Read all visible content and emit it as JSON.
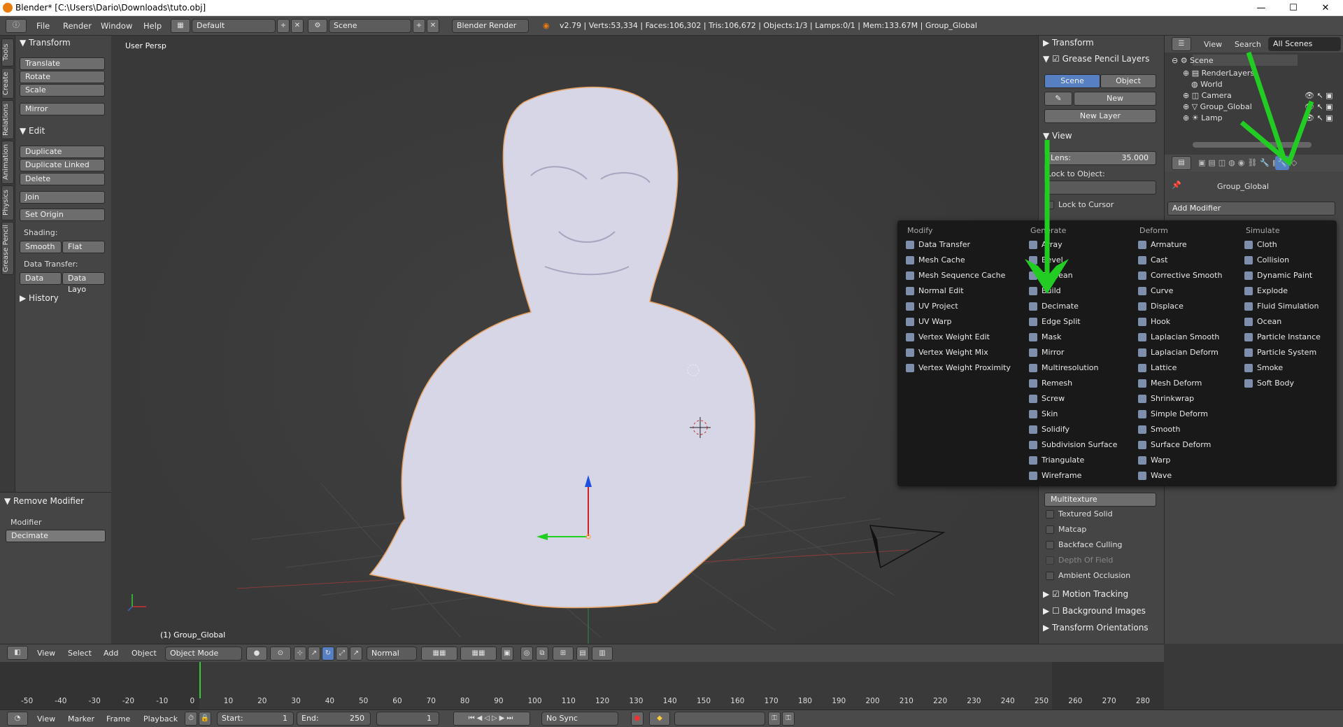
{
  "window": {
    "title": "Blender* [C:\\Users\\Dario\\Downloads\\tuto.obj]",
    "minimize": "—",
    "maximize": "☐",
    "close": "✕"
  },
  "topbar": {
    "menus": [
      "File",
      "Render",
      "Window",
      "Help"
    ],
    "layout": "Default",
    "scene": "Scene",
    "engine": "Blender Render",
    "stats": "v2.79 | Verts:53,334 | Faces:106,302 | Tris:106,672 | Objects:1/3 | Lamps:0/1 | Mem:133.67M | Group_Global"
  },
  "vtabs": [
    "Tools",
    "Create",
    "Relations",
    "Animation",
    "Physics",
    "Grease Pencil"
  ],
  "toolshelf": {
    "transform_header": "Transform",
    "transform_buttons": [
      "Translate",
      "Rotate",
      "Scale",
      "Mirror"
    ],
    "edit_header": "Edit",
    "edit_buttons": [
      "Duplicate",
      "Duplicate Linked",
      "Delete",
      "Join",
      "Set Origin"
    ],
    "shading_label": "Shading:",
    "smooth": "Smooth",
    "flat": "Flat",
    "data_transfer_label": "Data Transfer:",
    "data": "Data",
    "data_layo": "Data Layo",
    "history_header": "History"
  },
  "oppanel": {
    "header": "Remove Modifier",
    "label": "Modifier",
    "value": "Decimate"
  },
  "viewport": {
    "view_label": "User Persp",
    "object_label": "(1) Group_Global"
  },
  "npanel": {
    "transform": "Transform",
    "grease": "Grease Pencil Layers",
    "scene_btn": "Scene",
    "object_btn": "Object",
    "new_btn": "New",
    "new_layer_btn": "New Layer",
    "view": "View",
    "lens_label": "Lens:",
    "lens_value": "35.000",
    "lock_object": "Lock to Object:",
    "lock_cursor": "Lock to Cursor",
    "shading_value": "Multitexture",
    "shading_opts": [
      "Textured Solid",
      "Matcap",
      "Backface Culling",
      "Depth Of Field",
      "Ambient Occlusion"
    ],
    "motion": "Motion Tracking",
    "bg_images": "Background Images",
    "orientations": "Transform Orientations"
  },
  "outliner": {
    "menus": [
      "View",
      "Search"
    ],
    "filter": "All Scenes",
    "items": [
      "Scene",
      "RenderLayers",
      "World",
      "Camera",
      "Group_Global",
      "Lamp"
    ]
  },
  "props": {
    "object": "Group_Global",
    "add_modifier": "Add Modifier"
  },
  "popup": {
    "columns": [
      {
        "header": "Modify",
        "items": [
          "Data Transfer",
          "Mesh Cache",
          "Mesh Sequence Cache",
          "Normal Edit",
          "UV Project",
          "UV Warp",
          "Vertex Weight Edit",
          "Vertex Weight Mix",
          "Vertex Weight Proximity"
        ]
      },
      {
        "header": "Generate",
        "items": [
          "Array",
          "Bevel",
          "Boolean",
          "Build",
          "Decimate",
          "Edge Split",
          "Mask",
          "Mirror",
          "Multiresolution",
          "Remesh",
          "Screw",
          "Skin",
          "Solidify",
          "Subdivision Surface",
          "Triangulate",
          "Wireframe"
        ]
      },
      {
        "header": "Deform",
        "items": [
          "Armature",
          "Cast",
          "Corrective Smooth",
          "Curve",
          "Displace",
          "Hook",
          "Laplacian Smooth",
          "Laplacian Deform",
          "Lattice",
          "Mesh Deform",
          "Shrinkwrap",
          "Simple Deform",
          "Smooth",
          "Surface Deform",
          "Warp",
          "Wave"
        ]
      },
      {
        "header": "Simulate",
        "items": [
          "Cloth",
          "Collision",
          "Dynamic Paint",
          "Explode",
          "Fluid Simulation",
          "Ocean",
          "Particle Instance",
          "Particle System",
          "Smoke",
          "Soft Body"
        ]
      }
    ]
  },
  "vhdr": {
    "menus": [
      "View",
      "Select",
      "Add",
      "Object"
    ],
    "mode": "Object Mode",
    "pivot": "Normal"
  },
  "timeline": {
    "ticks": [
      "-50",
      "-40",
      "-30",
      "-20",
      "-10",
      "0",
      "10",
      "20",
      "30",
      "40",
      "50",
      "60",
      "70",
      "80",
      "90",
      "100",
      "110",
      "120",
      "130",
      "140",
      "150",
      "160",
      "170",
      "180",
      "190",
      "200",
      "210",
      "220",
      "230",
      "240",
      "250",
      "260",
      "270",
      "280"
    ],
    "menus": [
      "View",
      "Marker",
      "Frame",
      "Playback"
    ],
    "start": "Start:",
    "start_val": "1",
    "end": "End:",
    "end_val": "250",
    "current": "1",
    "sync": "No Sync"
  },
  "colors": {
    "accent": "#5680c2",
    "arrow": "#22cc22",
    "popup_bg": "#191919",
    "model": "#d6d6e6"
  }
}
